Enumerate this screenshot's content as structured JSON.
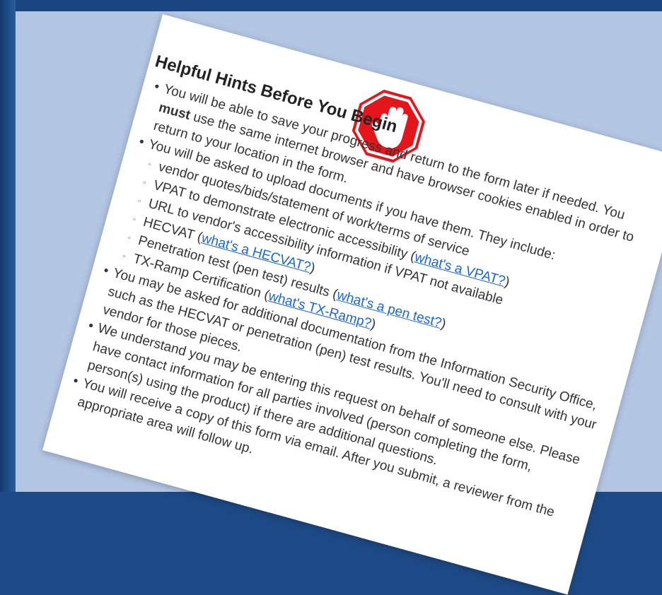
{
  "colors": {
    "stop_red": "#e4161b",
    "link": "#1a66cc",
    "slide_bg": "#b3c6e4",
    "frame": "#1d4a86"
  },
  "icons": {
    "stop": "stop-hand-icon"
  },
  "doc": {
    "title": "Helpful Hints Before You Begin",
    "b1": {
      "text_a": "You will be able to save your progress and return to the form later if needed. You ",
      "bold": "must",
      "text_b": " use the same internet browser and have browser cookies enabled in order to return to your location in the form."
    },
    "b2": {
      "text": "You will be asked to upload documents if you have them. They include:",
      "s1": "vendor quotes/bids/statement of work/terms of service",
      "s2_text": "VPAT to demonstrate electronic accessibility (",
      "s2_link": "what's a VPAT?",
      "s2_close": ")",
      "s3": "URL to vendor's accessibility information if VPAT not available",
      "s4_text": "HECVAT (",
      "s4_link": "what's a HECVAT?",
      "s4_close": ")",
      "s5_text": "Penetration test (pen test) results (",
      "s5_link": "what's a pen test?",
      "s5_close": ")",
      "s6_text": "TX-Ramp Certification (",
      "s6_link": "what's TX-Ramp?",
      "s6_close": ")"
    },
    "b3": "You may be asked for additional documentation from the Information Security Office, such as the HECVAT or penetration (pen) test results. You'll need to consult with your vendor for those pieces.",
    "b4": "We understand you may be entering this request on behalf of someone else. Please have contact information for all parties involved (person completing the form, person(s) using the product) if there are additional questions.",
    "b5": "You will receive a copy of this form via email. After you submit, a reviewer from the appropriate area will follow up."
  }
}
